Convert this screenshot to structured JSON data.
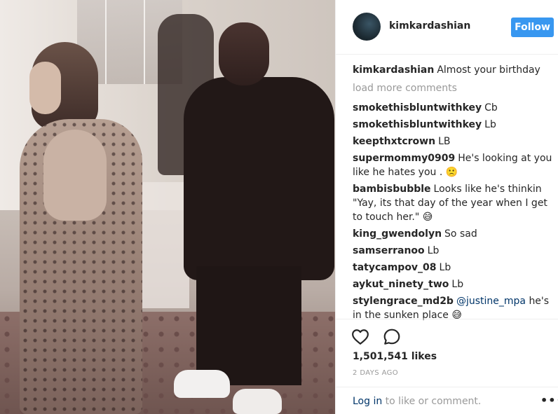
{
  "post": {
    "author": "kimkardashian",
    "follow_label": "Follow",
    "caption_user": "kimkardashian",
    "caption_text": "Almost your birthday",
    "load_more_label": "load more comments",
    "comments": [
      {
        "user": "smokethisbluntwithkey",
        "text": "Cb"
      },
      {
        "user": "smokethisbluntwithkey",
        "text": "Lb"
      },
      {
        "user": "keepthxtcrown",
        "text": "LB"
      },
      {
        "user": "supermommy0909",
        "text": "He's looking at you like he hates you . 🙁"
      },
      {
        "user": "bambisbubble",
        "text": "Looks like he's thinkin \"Yay, its that day of the year when I get to touch her.\" 😅"
      },
      {
        "user": "king_gwendolyn",
        "text": "So sad"
      },
      {
        "user": "samserranoo",
        "text": "Lb"
      },
      {
        "user": "tatycampov_08",
        "text": "Lb"
      },
      {
        "user": "aykut_ninety_two",
        "text": "Lb"
      }
    ],
    "last_comment": {
      "user": "stylengrace_md2b",
      "mention": "@justine_mpa",
      "text": "he's in the sunken place 😅"
    },
    "likes": "1,501,541 likes",
    "timestamp": "2 DAYS AGO",
    "login_link": "Log in",
    "login_suffix": "to like or comment.",
    "more_label": "•••",
    "icons": [
      "heart-icon",
      "comment-icon",
      "more-options-icon"
    ],
    "colors": {
      "follow": "#3897f0",
      "link": "#003569",
      "muted": "#999999"
    }
  }
}
